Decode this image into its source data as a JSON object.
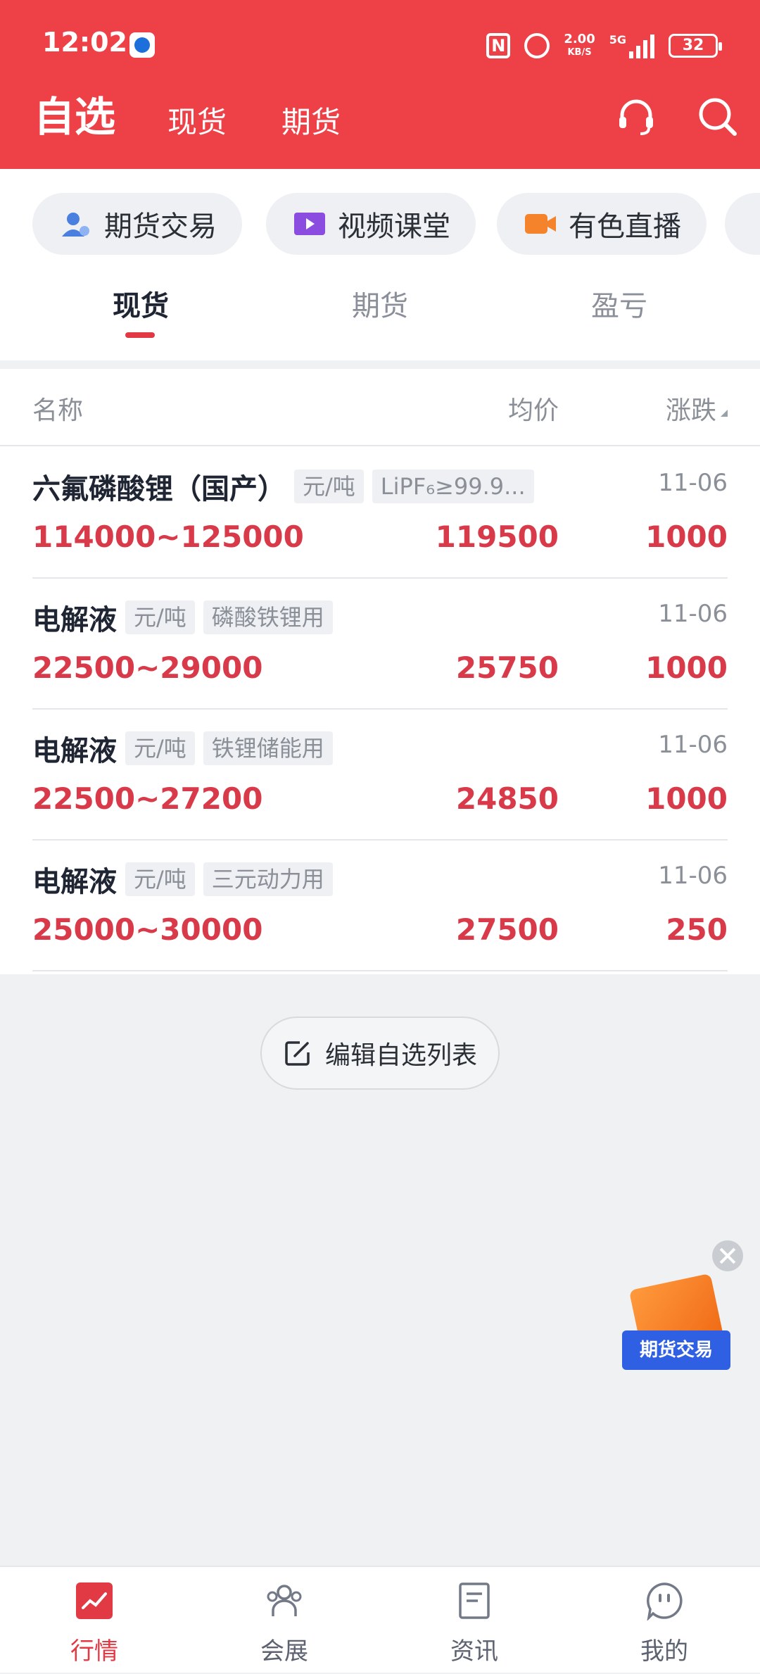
{
  "status_bar": {
    "time": "12:02",
    "nfc": "N",
    "net_speed": "2.00",
    "net_unit": "KB/S",
    "network": "5G",
    "battery": "32"
  },
  "header": {
    "title": "自选",
    "tabs": [
      "现货",
      "期货"
    ],
    "icons": [
      "headset-icon",
      "search-icon"
    ]
  },
  "shortcuts": [
    {
      "label": "期货交易",
      "icon": "user-trade-icon",
      "color": "#4a7fe0"
    },
    {
      "label": "视频课堂",
      "icon": "video-icon",
      "color": "#8a4ddf"
    },
    {
      "label": "有色直播",
      "icon": "camera-icon",
      "color": "#f5832b"
    }
  ],
  "subtabs": {
    "items": [
      "现货",
      "期货",
      "盈亏"
    ],
    "active": 0
  },
  "columns": {
    "name": "名称",
    "avg": "均价",
    "change": "涨跌"
  },
  "rows": [
    {
      "name": "六氟磷酸锂（国产）",
      "unit": "元/吨",
      "spec": "LiPF₆≥99.9...",
      "date": "11-06",
      "range": "114000~125000",
      "avg": "119500",
      "change": "1000"
    },
    {
      "name": "电解液",
      "unit": "元/吨",
      "spec": "磷酸铁锂用",
      "date": "11-06",
      "range": "22500~29000",
      "avg": "25750",
      "change": "1000"
    },
    {
      "name": "电解液",
      "unit": "元/吨",
      "spec": "铁锂储能用",
      "date": "11-06",
      "range": "22500~27200",
      "avg": "24850",
      "change": "1000"
    },
    {
      "name": "电解液",
      "unit": "元/吨",
      "spec": "三元动力用",
      "date": "11-06",
      "range": "25000~30000",
      "avg": "27500",
      "change": "250"
    }
  ],
  "edit_button": "编辑自选列表",
  "float_ad": {
    "label": "期货交易"
  },
  "bottom_nav": {
    "items": [
      {
        "label": "行情",
        "icon": "chart-icon"
      },
      {
        "label": "会展",
        "icon": "people-icon"
      },
      {
        "label": "资讯",
        "icon": "document-icon"
      },
      {
        "label": "我的",
        "icon": "profile-icon"
      }
    ],
    "active": 0
  },
  "colors": {
    "brand_red": "#ee4147",
    "price_red": "#d93a4a",
    "accent_red": "#e23a45"
  }
}
